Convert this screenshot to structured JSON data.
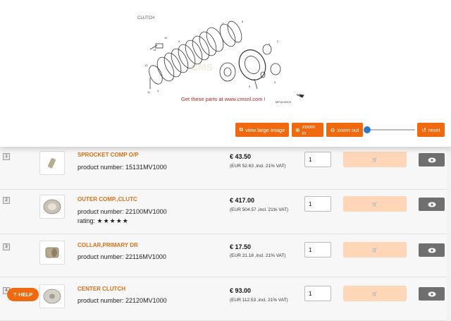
{
  "diagram": {
    "section_label": "CLUTCH",
    "link_text": "Get these parts at www.cmsnl.com !",
    "code": "MFL8-MV03"
  },
  "toolbar": {
    "view_large": "view large image",
    "zoom_in": "zoom in",
    "zoom_out": "zoom out",
    "reset": "reset",
    "zoom_level": 0.0
  },
  "products": [
    {
      "index": "1",
      "name": "SPROCKET COMP O/P",
      "number": "product number: 15131MV1000",
      "price": "€ 43.50",
      "vat": "(EUR 52.63 ,incl. 21% VAT)",
      "qty": "1",
      "rating_label": "",
      "stars": ""
    },
    {
      "index": "2",
      "name": "OUTER COMP.,CLUTC",
      "number": "product number: 22100MV1000",
      "price": "€ 417.00",
      "vat": "(EUR 504.57 ,incl. 21% VAT)",
      "qty": "1",
      "rating_label": "rating:",
      "stars": "★★★★★"
    },
    {
      "index": "3",
      "name": "COLLAR,PRIMARY DR",
      "number": "product number: 22116MV1000",
      "price": "€ 17.50",
      "vat": "(EUR 21.18 ,incl. 21% VAT)",
      "qty": "1",
      "rating_label": "",
      "stars": ""
    },
    {
      "index": "4",
      "name": "CENTER CLUTCH",
      "number": "product number: 22120MV1000",
      "price": "€ 93.00",
      "vat": "(EUR 112.53 ,incl. 21% VAT)",
      "qty": "1",
      "rating_label": "",
      "stars": ""
    }
  ],
  "help": {
    "label": "HELP"
  },
  "colors": {
    "accent": "#f0690f",
    "title": "#d8701a",
    "eye": "#6f6f6f",
    "cart": "#ffd6b8"
  }
}
